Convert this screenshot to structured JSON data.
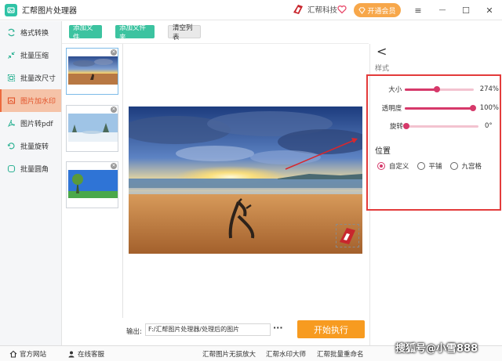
{
  "titlebar": {
    "app_title": "汇帮图片处理器",
    "brand_name": "汇帮科技",
    "vip_label": "开通会员",
    "menu_icon": "≡",
    "minimize_icon": "—",
    "maximize_icon": "☐",
    "close_icon": "✕"
  },
  "sidebar": {
    "items": [
      {
        "label": "格式转换",
        "icon": "format-convert-icon"
      },
      {
        "label": "批量压缩",
        "icon": "compress-icon"
      },
      {
        "label": "批量改尺寸",
        "icon": "resize-icon"
      },
      {
        "label": "图片加水印",
        "icon": "watermark-icon",
        "active": true
      },
      {
        "label": "图片转pdf",
        "icon": "pdf-icon"
      },
      {
        "label": "批量旋转",
        "icon": "rotate-icon"
      },
      {
        "label": "批量圆角",
        "icon": "round-corner-icon"
      }
    ]
  },
  "toolbar": {
    "add_file": "添加文件",
    "add_folder": "添加文件夹",
    "clear_list": "清空列表"
  },
  "right_panel": {
    "back": "<",
    "style_title": "样式",
    "sliders": [
      {
        "label": "大小",
        "value_text": "274%",
        "fraction": 0.47
      },
      {
        "label": "透明度",
        "value_text": "100%",
        "fraction": 1.0
      },
      {
        "label": "旋转",
        "value_text": "0°",
        "fraction": 0.0
      }
    ],
    "position_title": "位置",
    "position_options": [
      {
        "label": "自定义",
        "checked": true
      },
      {
        "label": "平铺",
        "checked": false
      },
      {
        "label": "九宫格",
        "checked": false
      }
    ]
  },
  "output": {
    "label": "输出:",
    "path": "F:/汇帮图片处理器/处理后的图片",
    "more": "···",
    "start_button": "开始执行"
  },
  "bottombar": {
    "website": "官方网站",
    "service": "在线客服",
    "links": [
      "汇帮图片无损放大",
      "汇帮水印大师",
      "汇帮批量重命名"
    ]
  },
  "overlay_text": "搜狐号@小雪888",
  "colors": {
    "accent_green": "#3cc3a0",
    "active_orange": "#ec6a3e",
    "slider_pink": "#d6396a",
    "start_orange": "#f79b20",
    "annotation_red": "#e33b3b"
  }
}
